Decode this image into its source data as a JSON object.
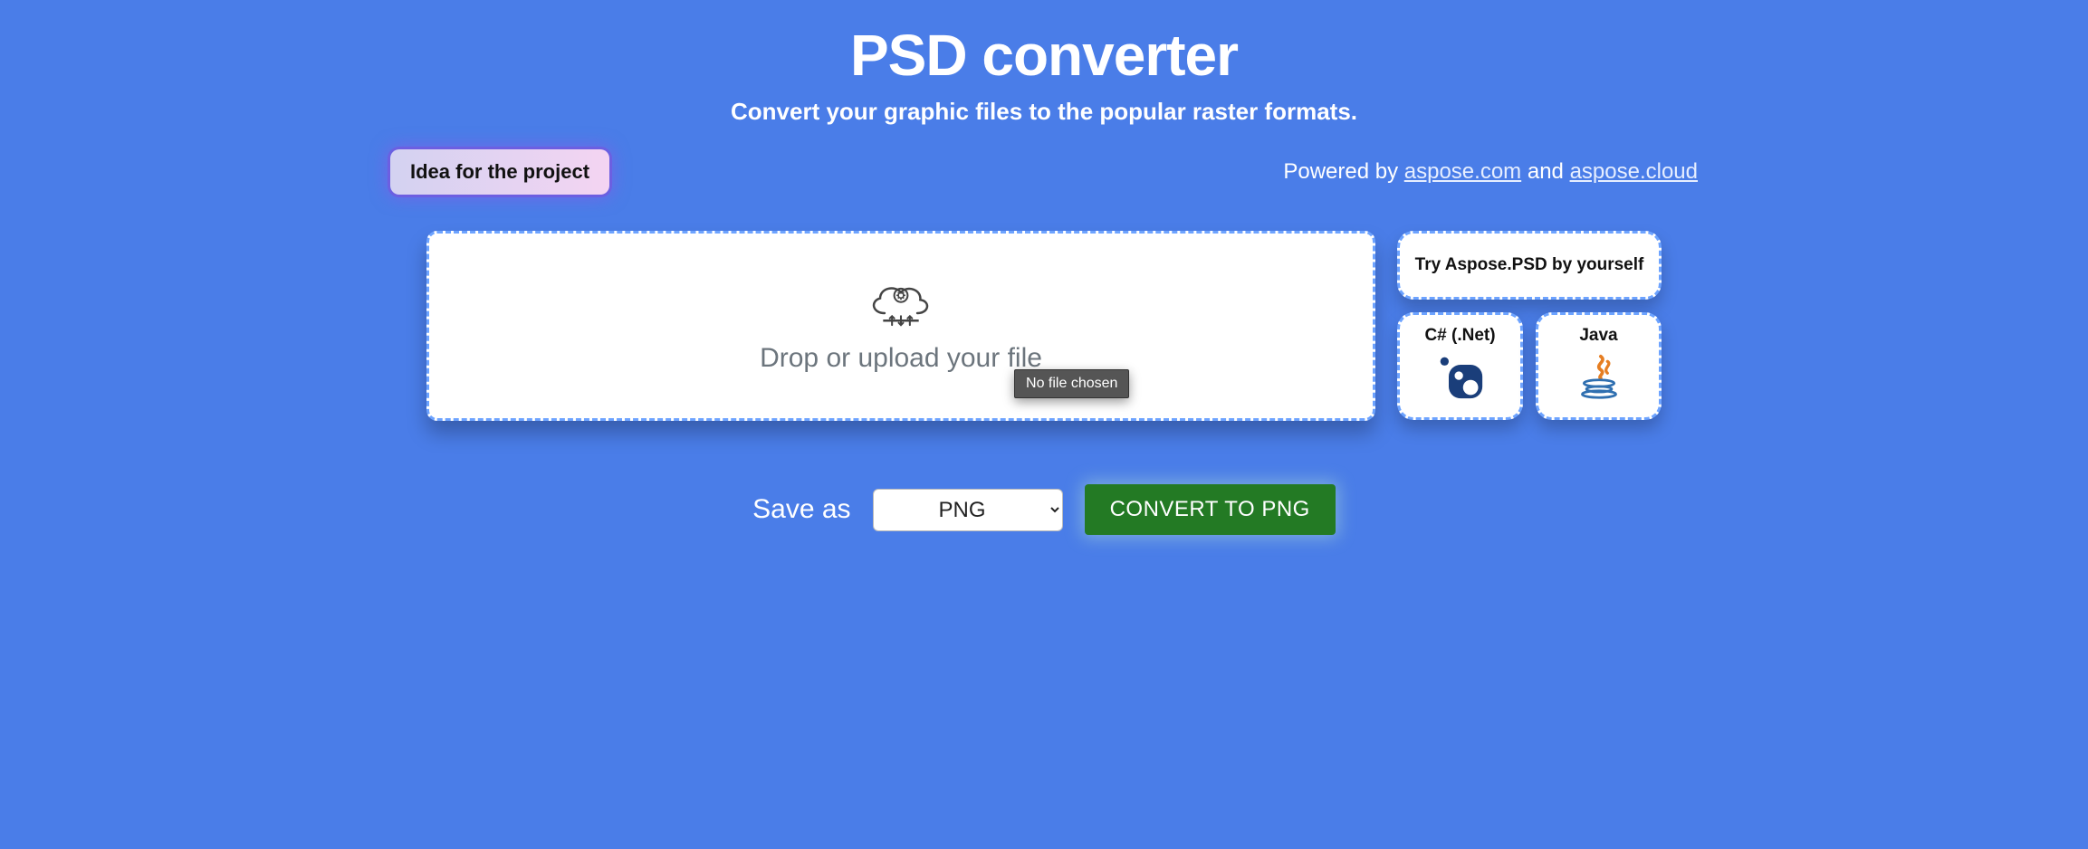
{
  "header": {
    "title": "PSD converter",
    "subtitle": "Convert your graphic files to the popular raster formats."
  },
  "idea_button": {
    "label": "Idea for the project"
  },
  "powered": {
    "prefix": "Powered by ",
    "link1": "aspose.com",
    "mid": " and ",
    "link2": "aspose.cloud"
  },
  "dropzone": {
    "label": "Drop or upload your file",
    "tooltip": "No file chosen"
  },
  "side": {
    "try_label": "Try Aspose.PSD by yourself",
    "csharp_label": "C# (.Net)",
    "java_label": "Java"
  },
  "save": {
    "label": "Save as",
    "selected": "PNG",
    "button_label": "CONVERT TO PNG"
  }
}
